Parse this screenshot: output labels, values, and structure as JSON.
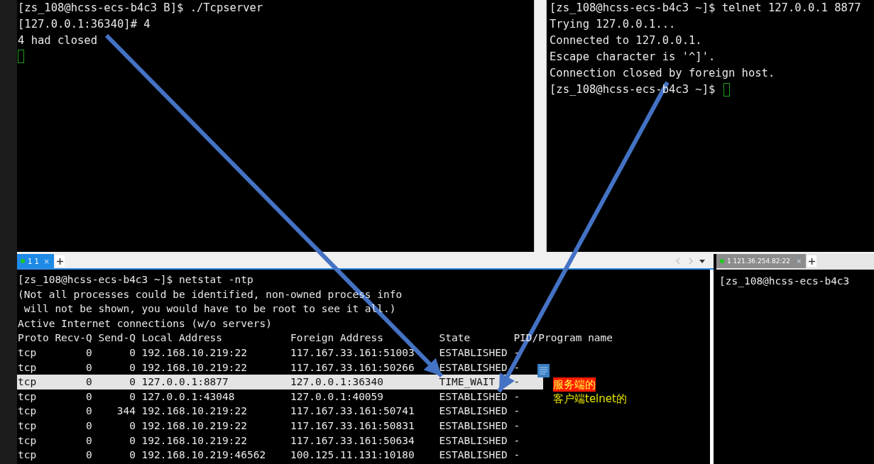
{
  "top_left_terminal": {
    "lines": [
      "[zs_108@hcss-ecs-b4c3 B]$ ./Tcpserver",
      "[127.0.0.1:36340]# 4",
      "4 had closed"
    ],
    "cursor": true
  },
  "top_right_terminal": {
    "lines": [
      "[zs_108@hcss-ecs-b4c3 ~]$ telnet 127.0.0.1 8877",
      "Trying 127.0.0.1...",
      "Connected to 127.0.0.1.",
      "Escape character is '^]'.",
      "Connection closed by foreign host.",
      "[zs_108@hcss-ecs-b4c3 ~]$ "
    ],
    "cursor": true
  },
  "bottom_left_tabs": [
    {
      "label": "1 1",
      "selected": true,
      "close": "×"
    }
  ],
  "bottom_left_terminal": {
    "lines": [
      {
        "text": "[zs_108@hcss-ecs-b4c3 ~]$ netstat -ntp",
        "selected": false
      },
      {
        "text": "(Not all processes could be identified, non-owned process info",
        "selected": false
      },
      {
        "text": " will not be shown, you would have to be root to see it all.)",
        "selected": false
      },
      {
        "text": "Active Internet connections (w/o servers)",
        "selected": false
      },
      {
        "text": "Proto Recv-Q Send-Q Local Address           Foreign Address         State       PID/Program name",
        "selected": false
      },
      {
        "text": "tcp        0      0 192.168.10.219:22       117.167.33.161:51003    ESTABLISHED -",
        "selected": false
      },
      {
        "text": "tcp        0      0 192.168.10.219:22       117.167.33.161:50266    ESTABLISHED -",
        "selected": false
      },
      {
        "text": "tcp        0      0 127.0.0.1:8877          127.0.0.1:36340         TIME_WAIT   -",
        "selected": true
      },
      {
        "text": "tcp        0      0 127.0.0.1:43048         127.0.0.1:40059         ESTABLISHED -",
        "selected": false
      },
      {
        "text": "tcp        0    344 192.168.10.219:22       117.167.33.161:50741    ESTABLISHED -",
        "selected": false
      },
      {
        "text": "tcp        0      0 192.168.10.219:22       117.167.33.161:50831    ESTABLISHED -",
        "selected": false
      },
      {
        "text": "tcp        0      0 192.168.10.219:22       117.167.33.161:50634    ESTABLISHED -",
        "selected": false
      },
      {
        "text": "tcp        0      0 192.168.10.219:46562    100.125.11.131:10180    ESTABLISHED -",
        "selected": false
      }
    ]
  },
  "bottom_right_tabs": [
    {
      "label": "1 121.36.254.82:22",
      "selected": false,
      "close": "×"
    }
  ],
  "bottom_right_terminal": {
    "lines": [
      "[zs_108@hcss-ecs-b4c3"
    ]
  },
  "annotations": [
    {
      "text": "服务端的",
      "kind": "highlight"
    },
    {
      "text": "客户端telnet的",
      "kind": "plain"
    }
  ]
}
